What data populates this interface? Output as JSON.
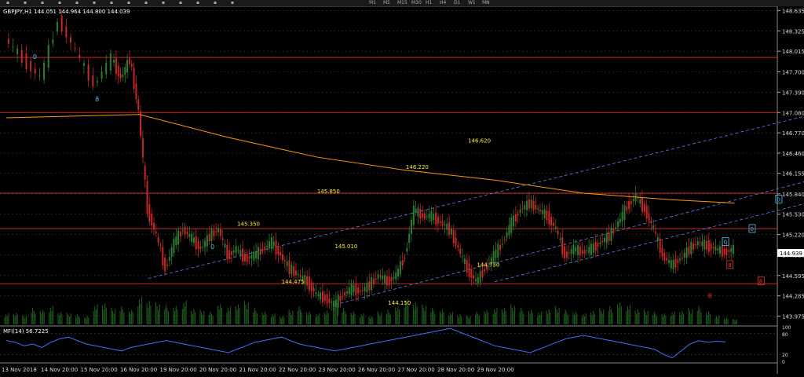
{
  "toolbar": {
    "icons": [
      "cursor-icon",
      "crosshair-icon",
      "vline-icon",
      "hline-icon",
      "trendline-icon",
      "channel-icon",
      "fibo-icon",
      "text-icon",
      "label-icon",
      "arrow-icon",
      "arrow-down-icon",
      "arrow-up-icon",
      "period-icon",
      "zoom-icon"
    ],
    "timeframes": [
      "M1",
      "M5",
      "M15",
      "M30",
      "H1",
      "H4",
      "D1",
      "W1",
      "MN"
    ]
  },
  "chart_data": {
    "type": "candlestick",
    "symbol_header": "GBPJPY,H1  144.051 144.964 144.800 144.039",
    "current_price": "144.939",
    "price_axis_ticks": [
      "148.635",
      "148.325",
      "148.015",
      "147.700",
      "147.390",
      "147.080",
      "146.770",
      "146.460",
      "146.155",
      "145.840",
      "145.530",
      "145.220",
      "144.910",
      "144.595",
      "144.285",
      "143.975"
    ],
    "ylim": [
      143.85,
      148.7
    ],
    "time_axis_ticks": [
      "13 Nov 2018",
      "14 Nov 20:00",
      "15 Nov 20:00",
      "16 Nov 20:00",
      "19 Nov 20:00",
      "20 Nov 20:00",
      "21 Nov 20:00",
      "22 Nov 20:00",
      "23 Nov 20:00",
      "26 Nov 20:00",
      "27 Nov 20:00",
      "28 Nov 20:00",
      "29 Nov 20:00"
    ],
    "level_labels": [
      "146.620",
      "146.220",
      "145.850",
      "145.350",
      "145.010",
      "144.730",
      "144.475",
      "144.150"
    ],
    "horizontal_levels": [
      147.92,
      147.08,
      145.85,
      145.31,
      144.47
    ],
    "close_path": [
      [
        0,
        148.2
      ],
      [
        2,
        147.9
      ],
      [
        4,
        147.6
      ],
      [
        6,
        148.5
      ],
      [
        8,
        148.0
      ],
      [
        10,
        147.5
      ],
      [
        12,
        147.9
      ],
      [
        13,
        147.6
      ],
      [
        14,
        147.9
      ],
      [
        15,
        147.1
      ],
      [
        16,
        145.6
      ],
      [
        17,
        145.2
      ],
      [
        18,
        144.7
      ],
      [
        19,
        145.1
      ],
      [
        20,
        145.3
      ],
      [
        21,
        145.15
      ],
      [
        22,
        145.0
      ],
      [
        23,
        145.2
      ],
      [
        24,
        145.3
      ],
      [
        25,
        144.9
      ],
      [
        26,
        145.0
      ],
      [
        27,
        144.85
      ],
      [
        28,
        144.9
      ],
      [
        29,
        145.0
      ],
      [
        30,
        145.1
      ],
      [
        31,
        144.9
      ],
      [
        32,
        144.7
      ],
      [
        33,
        144.6
      ],
      [
        34,
        144.5
      ],
      [
        35,
        144.3
      ],
      [
        36,
        144.25
      ],
      [
        37,
        144.15
      ],
      [
        38,
        144.3
      ],
      [
        39,
        144.4
      ],
      [
        40,
        144.35
      ],
      [
        41,
        144.45
      ],
      [
        42,
        144.6
      ],
      [
        43,
        144.5
      ],
      [
        44,
        144.6
      ],
      [
        45,
        144.9
      ],
      [
        46,
        145.6
      ],
      [
        47,
        145.5
      ],
      [
        48,
        145.5
      ],
      [
        49,
        145.4
      ],
      [
        50,
        145.3
      ],
      [
        51,
        145.0
      ],
      [
        52,
        144.7
      ],
      [
        53,
        144.5
      ],
      [
        54,
        144.7
      ],
      [
        55,
        144.9
      ],
      [
        56,
        145.1
      ],
      [
        57,
        145.4
      ],
      [
        58,
        145.6
      ],
      [
        59,
        145.7
      ],
      [
        60,
        145.6
      ],
      [
        61,
        145.5
      ],
      [
        62,
        145.3
      ],
      [
        63,
        144.9
      ],
      [
        64,
        145.0
      ],
      [
        65,
        144.95
      ],
      [
        66,
        145.0
      ],
      [
        67,
        145.1
      ],
      [
        68,
        145.2
      ],
      [
        69,
        145.4
      ],
      [
        70,
        145.65
      ],
      [
        71,
        145.8
      ],
      [
        72,
        145.6
      ],
      [
        73,
        145.3
      ],
      [
        74,
        144.9
      ],
      [
        75,
        144.75
      ],
      [
        76,
        144.85
      ],
      [
        77,
        145.0
      ],
      [
        78,
        145.1
      ],
      [
        79,
        145.05
      ],
      [
        80,
        145.0
      ],
      [
        81,
        144.95
      ],
      [
        82,
        145.0
      ]
    ],
    "ma_line": [
      [
        0,
        147.0
      ],
      [
        15,
        147.05
      ],
      [
        25,
        146.7
      ],
      [
        35,
        146.4
      ],
      [
        45,
        146.2
      ],
      [
        55,
        146.05
      ],
      [
        65,
        145.85
      ],
      [
        75,
        145.75
      ],
      [
        82,
        145.7
      ]
    ],
    "channel_lines": [
      {
        "x0": 16,
        "y0": 144.55,
        "x1": 140,
        "y1": 148.7
      },
      {
        "x0": 37,
        "y0": 144.15,
        "x1": 140,
        "y1": 147.8
      },
      {
        "x0": 55,
        "y0": 144.5,
        "x1": 140,
        "y1": 147.4
      }
    ],
    "markers": [
      {
        "label": "8",
        "x": 10,
        "y": 147.25,
        "color": "#4fc3f7"
      },
      {
        "label": "0",
        "x": 23,
        "y": 145.0,
        "color": "#4fc3f7"
      },
      {
        "label": "0",
        "x": 3,
        "y": 147.9,
        "color": "#4fc3f7"
      },
      {
        "label": "8",
        "x": 79,
        "y": 144.25,
        "color": "#e53935"
      }
    ],
    "boxes": [
      {
        "label": "0",
        "x": 87,
        "y": 145.75,
        "color": "#4fc3f7"
      },
      {
        "label": "0",
        "x": 84,
        "y": 145.3,
        "color": "#4fc3f7"
      },
      {
        "label": "0",
        "x": 81,
        "y": 145.1,
        "color": "#4fc3f7"
      },
      {
        "label": "8",
        "x": 81.5,
        "y": 144.75,
        "color": "#e53935"
      },
      {
        "label": "8",
        "x": 85,
        "y": 144.5,
        "color": "#e53935"
      }
    ],
    "volume_bars": [
      12,
      14,
      10,
      18,
      16,
      20,
      15,
      13,
      11,
      9,
      22,
      25,
      18,
      20,
      16,
      30,
      28,
      24,
      22,
      20,
      26,
      18,
      16,
      14,
      22,
      20,
      24,
      26,
      18,
      14,
      12,
      10,
      16,
      20,
      14,
      12,
      16,
      22,
      18,
      14,
      12,
      10,
      14,
      16,
      20,
      28,
      26,
      22,
      18,
      16,
      14,
      12,
      10,
      14,
      16,
      18,
      20,
      22,
      18,
      16,
      14,
      18,
      20,
      16,
      14,
      12,
      16,
      18,
      20,
      24,
      22,
      18,
      16,
      14,
      12,
      14,
      16,
      18,
      20,
      14,
      10,
      8,
      6
    ],
    "mfi": {
      "label": "MFI(14) 56.7225",
      "levels": [
        "100",
        "80",
        "20",
        "0"
      ],
      "values": [
        60,
        55,
        45,
        50,
        40,
        55,
        65,
        70,
        60,
        50,
        45,
        40,
        35,
        30,
        40,
        45,
        50,
        55,
        60,
        55,
        50,
        45,
        40,
        35,
        30,
        25,
        35,
        45,
        55,
        60,
        65,
        70,
        60,
        50,
        45,
        40,
        35,
        30,
        35,
        40,
        45,
        50,
        55,
        60,
        65,
        70,
        75,
        80,
        85,
        90,
        95,
        85,
        75,
        65,
        55,
        45,
        40,
        35,
        30,
        25,
        35,
        45,
        55,
        65,
        70,
        75,
        70,
        65,
        60,
        55,
        50,
        45,
        40,
        35,
        20,
        10,
        30,
        50,
        60,
        55,
        58,
        56
      ]
    },
    "colors": {
      "bull": "#2e7d32",
      "bear": "#c62828",
      "ma": "#ff9800",
      "level": "#c62828",
      "channel": "#5b7fff",
      "level_text": "#ffeb3b",
      "grid": "#333333",
      "mfi_line": "#3f6fff",
      "volume": "#1f5a1f"
    }
  }
}
